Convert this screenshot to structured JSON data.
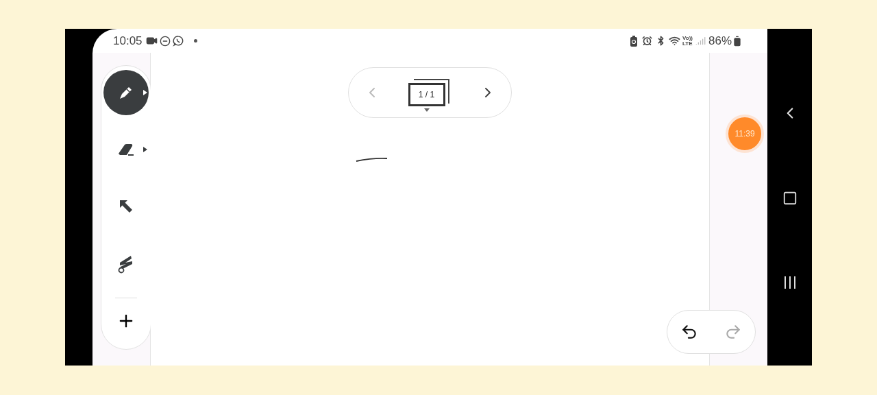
{
  "status_bar": {
    "time": "10:05",
    "volte": [
      "Vo))",
      "LTE"
    ],
    "battery": "86%"
  },
  "toolbar": {
    "tools": [
      {
        "kind": "pen",
        "selected": true,
        "submenu": true
      },
      {
        "kind": "eraser",
        "selected": false,
        "submenu": true
      },
      {
        "kind": "select",
        "selected": false,
        "submenu": false
      },
      {
        "kind": "lasso",
        "selected": false,
        "submenu": false
      }
    ],
    "add": {
      "kind": "add"
    }
  },
  "page_nav": {
    "prev_disabled": true,
    "next_disabled": false,
    "page": "1 / 1"
  },
  "timer": "11:39",
  "history": {
    "undo_disabled": false,
    "redo_disabled": true
  }
}
